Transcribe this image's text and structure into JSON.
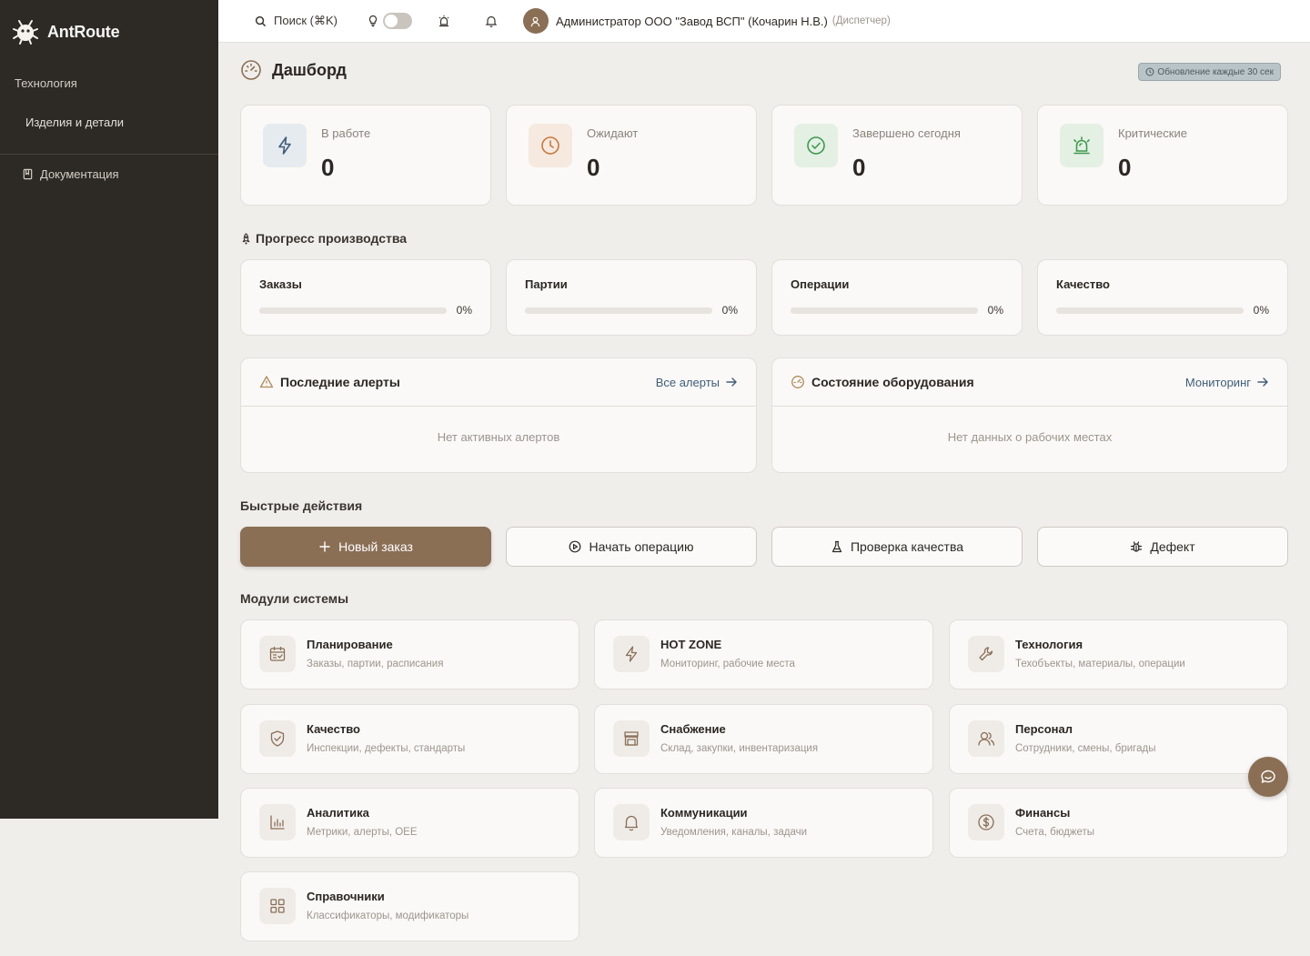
{
  "app": {
    "name": "AntRoute"
  },
  "sidebar": {
    "group": "Технология",
    "sub_item": "Изделия и детали",
    "docs": "Документация"
  },
  "topbar": {
    "search": "Поиск (⌘K)",
    "user_name": "Администратор ООО \"Завод ВСП\" (Кочарин Н.В.)",
    "user_role": "(Диспетчер)",
    "theme_toggle": false
  },
  "page": {
    "title": "Дашборд",
    "refresh": "Обновление каждые 30 сек"
  },
  "stats": [
    {
      "label": "В работе",
      "value": "0",
      "color": "#3f5d7a",
      "bg": "#e6ebef",
      "icon": "lightning-icon"
    },
    {
      "label": "Ожидают",
      "value": "0",
      "color": "#c9793c",
      "bg": "#f6e9df",
      "icon": "clock-icon"
    },
    {
      "label": "Завершено сегодня",
      "value": "0",
      "color": "#3f9a4f",
      "bg": "#e4f0e4",
      "icon": "check-circle-icon"
    },
    {
      "label": "Критические",
      "value": "0",
      "color": "#3f9a4f",
      "bg": "#e4f0e4",
      "icon": "siren-icon"
    }
  ],
  "progress": {
    "title": "Прогресс производства",
    "items": [
      {
        "label": "Заказы",
        "pct": "0%",
        "value": 0
      },
      {
        "label": "Партии",
        "pct": "0%",
        "value": 0
      },
      {
        "label": "Операции",
        "pct": "0%",
        "value": 0
      },
      {
        "label": "Качество",
        "pct": "0%",
        "value": 0
      }
    ]
  },
  "alerts": {
    "title": "Последние алерты",
    "link": "Все алерты",
    "empty": "Нет активных алертов"
  },
  "equipment": {
    "title": "Состояние оборудования",
    "link": "Мониторинг",
    "empty": "Нет данных о рабочих местах"
  },
  "quick_actions": {
    "title": "Быстрые действия",
    "items": [
      {
        "label": "Новый заказ"
      },
      {
        "label": "Начать операцию"
      },
      {
        "label": "Проверка качества"
      },
      {
        "label": "Дефект"
      }
    ]
  },
  "modules": {
    "title": "Модули системы",
    "items": [
      {
        "title": "Планирование",
        "desc": "Заказы, партии, расписания"
      },
      {
        "title": "HOT ZONE",
        "desc": "Мониторинг, рабочие места"
      },
      {
        "title": "Технология",
        "desc": "Техобъекты, материалы, операции"
      },
      {
        "title": "Качество",
        "desc": "Инспекции, дефекты, стандарты"
      },
      {
        "title": "Снабжение",
        "desc": "Склад, закупки, инвентаризация"
      },
      {
        "title": "Персонал",
        "desc": "Сотрудники, смены, бригады"
      },
      {
        "title": "Аналитика",
        "desc": "Метрики, алерты, OEE"
      },
      {
        "title": "Коммуникации",
        "desc": "Уведомления, каналы, задачи"
      },
      {
        "title": "Финансы",
        "desc": "Счета, бюджеты"
      },
      {
        "title": "Справочники",
        "desc": "Классификаторы, модификаторы"
      }
    ]
  },
  "colors": {
    "accent": "#8a6f55",
    "sidebar": "#2d2a26",
    "link": "#3f5d7a"
  }
}
